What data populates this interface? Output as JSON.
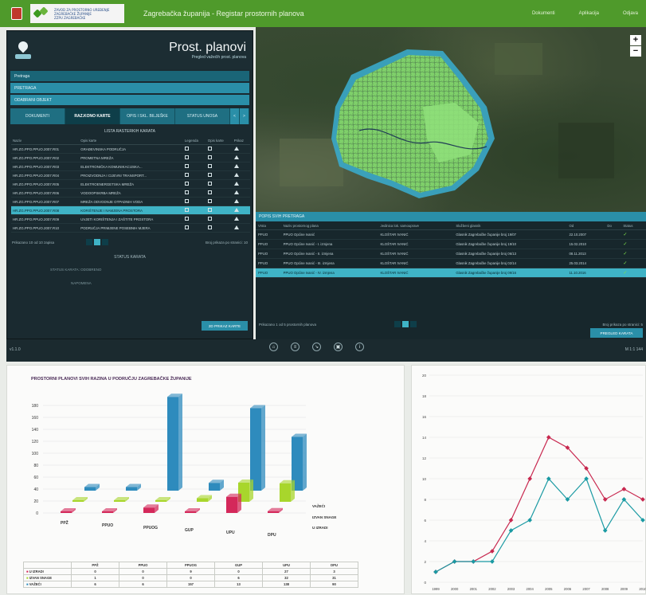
{
  "header": {
    "logo_text": [
      "ZAVOD ZA PROSTORNO UREĐENJE",
      "ZAGREBAČKE ŽUPANIJE",
      "ZZPU ZAGREBAČKE"
    ],
    "title": "Zagrebačka županija - Registar prostornih planova",
    "links": [
      "Dokumenti",
      "Aplikacija",
      "Odjava"
    ]
  },
  "left_panel": {
    "title": "Prost. planovi",
    "subtitle": "Pregled važećih prost. planova",
    "bars": [
      "Pretraga",
      "PRETRAGA",
      "ODABRANI OBJEKT"
    ],
    "tabs": [
      "DOKUMENTI",
      "RAZ.KONO KARTE",
      "OPIS I SKL. BILJEŠKE",
      "STATUS UNOSA",
      "<",
      ">"
    ],
    "table_title": "LISTA RASTERKIH KARATA",
    "columns": [
      "Naziv",
      "Opis karte",
      "Legenda",
      "Opis karte",
      "Prikaz"
    ],
    "rows": [
      [
        "HR.ZG.PPO.PPUO.2007.R01",
        "GRAĐEVINSKA PODRUČJA"
      ],
      [
        "HR.ZG.PPO.PPUO.2007.R02",
        "PROMETNA MREŽA"
      ],
      [
        "HR.ZG.PPO.PPUO.2007.R03",
        "ELEKTRONIČKA KOMUNIKACIJSKA..."
      ],
      [
        "HR.ZG.PPO.PPUO.2007.R04",
        "PROIZVODNJA I CIJEVNI TRANSPORT..."
      ],
      [
        "HR.ZG.PPO.PPUO.2007.R05",
        "ELEKTROENERGETSKA MREŽA"
      ],
      [
        "HR.ZG.PPO.PPUO.2007.R06",
        "VODOOPSKRBA MREŽA"
      ],
      [
        "HR.ZG.PPO.PPUO.2007.R07",
        "MREŽA ODVODNJE OTPADNIH VODA"
      ],
      [
        "HR.ZG.PPO.PPUO.2007.R08",
        "KORIŠTENJE I NAMJENA PROSTORA"
      ],
      [
        "HR.ZG.PPO.PPUO.2007.R09",
        "UVJETI KORIŠTENJA I ZAŠTITE PROSTORA"
      ],
      [
        "HR.ZG.PPO.PPUO.2007.R10",
        "PODRUČJA PRIMJENE POSEBNIH MJERA"
      ]
    ],
    "pager_text": "Prikazano 10 od 10 zapisa",
    "page_size_text": "Broj prikaza po stranici: 10",
    "status_title": "STATUS KARATA",
    "status_line1": "STATUS KARATA: ODOBRENO",
    "status_line2": "NAPOMENA",
    "button": "2D PRIKAZ KARTE"
  },
  "results": {
    "header": "POPIS SVIH PRETRAGA",
    "columns": [
      "Vrsta",
      "Naziv prostornog plana",
      "Jedinica lok. samouprave",
      "Službeni glasnik",
      "Od",
      "Do",
      "Status"
    ],
    "rows": [
      [
        "PPUO",
        "PPUO Općine Ivanić",
        "KLOŠTAR IVANIĆ",
        "Glasnik Zagrebačke županije broj 19/07",
        "22.10.2007",
        ""
      ],
      [
        "PPUO",
        "PPUO Općine Ivanić - I. izmjena",
        "KLOŠTAR IVANIĆ",
        "Glasnik Zagrebačke županije broj 19/10",
        "15.02.2010",
        ""
      ],
      [
        "PPUO",
        "PPUO Općine Ivanić - II. izmjena",
        "KLOŠTAR IVANIĆ",
        "Glasnik Zagrebačke županije broj 06/13",
        "08.11.2013",
        ""
      ],
      [
        "PPUO",
        "PPUO Općine Ivanić - III. izmjena",
        "KLOŠTAR IVANIĆ",
        "Glasnik Zagrebačke županije broj 02/14",
        "25.03.2014",
        ""
      ],
      [
        "PPUO",
        "PPUO Općine Ivanić - IV. izmjena",
        "KLOŠTAR IVANIĆ",
        "Glasnik Zagrebačke županije broj 09/16",
        "11.10.2016",
        ""
      ]
    ],
    "pager_text": "Prikazano 1 od 5 prostornih planova",
    "page_size_text": "Broj prikaza po stranici: 5",
    "button": "PREGLED KARATA"
  },
  "strip": {
    "version": "v1.1.0",
    "scale": "M 1:1 144"
  },
  "chart_data": [
    {
      "type": "bar",
      "title": "PROSTORNI PLANOVI SVIH RAZINA U PODRUČJU ZAGREBAČKE ŽUPANIJE",
      "categories": [
        "PPŽ",
        "PPUO",
        "PPUOG",
        "GUP",
        "UPU",
        "DPU"
      ],
      "series": [
        {
          "name": "U IZRADI",
          "values": [
            0,
            0,
            9,
            0,
            27,
            3
          ]
        },
        {
          "name": "IZVAN SNAGE",
          "values": [
            1,
            0,
            0,
            6,
            32,
            31
          ]
        },
        {
          "name": "VAŽEĆI",
          "values": [
            6,
            6,
            157,
            13,
            138,
            90
          ]
        }
      ],
      "ylim": [
        0,
        180
      ]
    },
    {
      "type": "line",
      "x": [
        "1999",
        "2000",
        "2001",
        "2002",
        "2003",
        "2004",
        "2005",
        "2006",
        "2007",
        "2008",
        "2009",
        "2010"
      ],
      "series": [
        {
          "values": [
            1,
            2,
            2,
            3,
            6,
            10,
            14,
            13,
            11,
            8,
            9,
            8
          ]
        },
        {
          "values": [
            1,
            2,
            2,
            2,
            5,
            6,
            10,
            8,
            10,
            5,
            8,
            6
          ]
        }
      ],
      "ylim": [
        0,
        20
      ]
    }
  ]
}
